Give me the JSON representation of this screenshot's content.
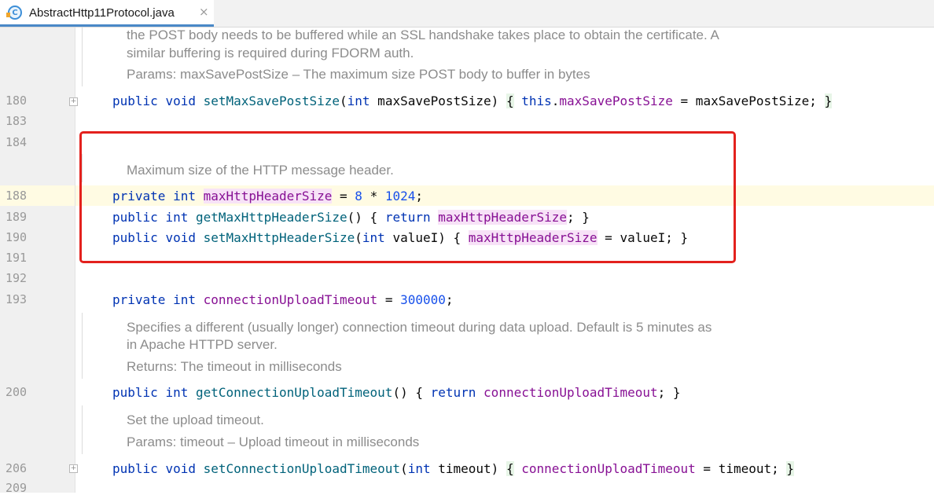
{
  "tab": {
    "icon_letter": "C",
    "title": "AbstractHttp11Protocol.java",
    "close": "×"
  },
  "gutter": {
    "lines": [
      "180",
      "183",
      "184",
      "188",
      "189",
      "190",
      "191",
      "192",
      "193",
      "200",
      "206",
      "209"
    ]
  },
  "doc": {
    "block1_line1": "the POST body needs to be buffered while an SSL handshake takes place to obtain the certificate. A",
    "block1_line2": "similar buffering is required during FDORM auth.",
    "block1_params": "Params: maxSavePostSize – The maximum size POST body to buffer in bytes",
    "block2": "Maximum size of the HTTP message header.",
    "block3_line1": "Specifies a different (usually longer) connection timeout during data upload. Default is 5 minutes as",
    "block3_line2": "in Apache HTTPD server.",
    "block3_returns": "Returns: The timeout in milliseconds",
    "block4_line1": "Set the upload timeout.",
    "block4_params": "Params: timeout – Upload timeout in milliseconds"
  },
  "code": {
    "l180": {
      "kw1": "public",
      "kw2": "void",
      "fn": "setMaxSavePostSize",
      "p1": "(",
      "ptype": "int",
      "param": " maxSavePostSize)",
      "b1": "{",
      "this": "this",
      "dot": ".",
      "fld": "maxSavePostSize",
      "eq": " = maxSavePostSize;",
      "b2": "}"
    },
    "l188": {
      "kw1": "private",
      "kw2": "int",
      "fld": "maxHttpHeaderSize",
      "eq": " = ",
      "n1": "8",
      "op": " * ",
      "n2": "1024",
      "end": ";"
    },
    "l189": {
      "kw1": "public",
      "kw2": "int",
      "fn": "getMaxHttpHeaderSize",
      "mid": "() { ",
      "ret": "return",
      "fld": "maxHttpHeaderSize",
      "end": "; }"
    },
    "l190": {
      "kw1": "public",
      "kw2": "void",
      "fn": "setMaxHttpHeaderSize",
      "p1": "(",
      "ptype": "int",
      "param": " valueI) { ",
      "fld": "maxHttpHeaderSize",
      "end": " = valueI; }"
    },
    "l193": {
      "kw1": "private",
      "kw2": "int",
      "fld": "connectionUploadTimeout",
      "eq": " = ",
      "n1": "300000",
      "end": ";"
    },
    "l200": {
      "kw1": "public",
      "kw2": "int",
      "fn": "getConnectionUploadTimeout",
      "mid": "() { ",
      "ret": "return",
      "fld": "connectionUploadTimeout",
      "end": "; }"
    },
    "l206": {
      "kw1": "public",
      "kw2": "void",
      "fn": "setConnectionUploadTimeout",
      "p1": "(",
      "ptype": "int",
      "param": " timeout)",
      "b1": "{",
      "fld": "connectionUploadTimeout",
      "eq": " = timeout;",
      "b2": "}"
    }
  },
  "colors": {
    "keyword": "#0033b3",
    "method": "#00627a",
    "field": "#871094",
    "number": "#1750eb",
    "highlight_box": "#e3211d"
  }
}
